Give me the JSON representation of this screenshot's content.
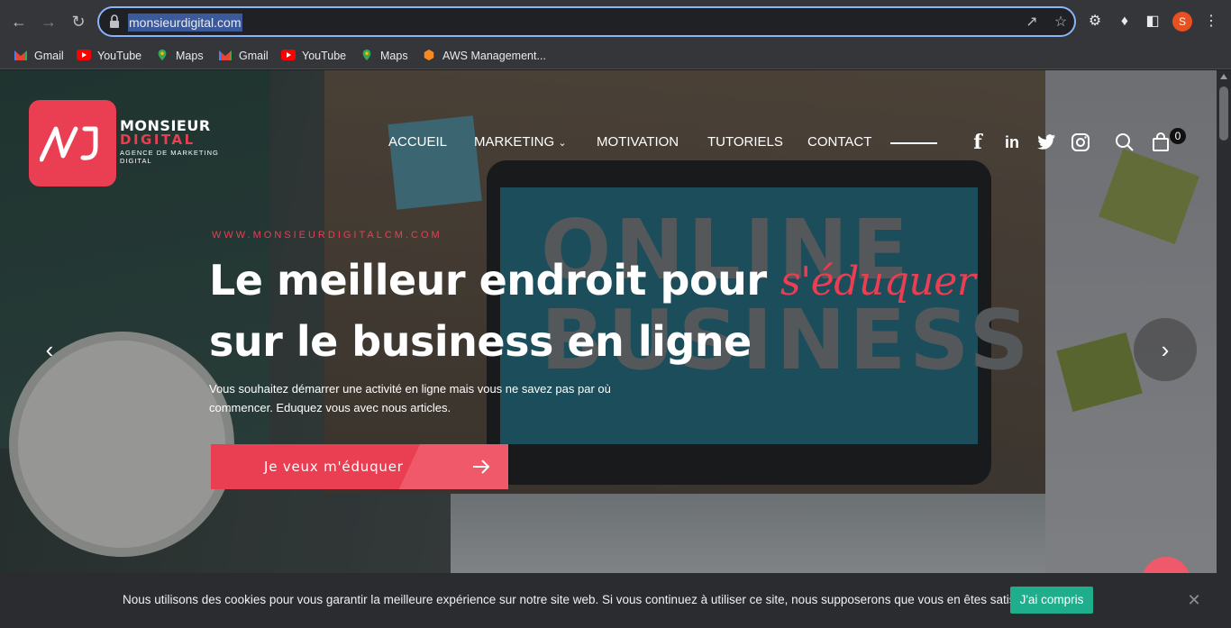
{
  "browser": {
    "url": "monsieurdigital.com",
    "profile_initial": "S",
    "accent_color": "#8ab4f8",
    "icons": [
      "back-icon",
      "forward-icon",
      "reload-icon",
      "lock-icon",
      "share-icon",
      "star-icon",
      "extension-icon",
      "puzzle-icon",
      "sidepanel-icon",
      "menu-icon"
    ]
  },
  "bookmarks": [
    {
      "label": "Gmail",
      "icon": "gmail-icon"
    },
    {
      "label": "YouTube",
      "icon": "youtube-icon"
    },
    {
      "label": "Maps",
      "icon": "maps-icon"
    },
    {
      "label": "Gmail",
      "icon": "gmail-icon"
    },
    {
      "label": "YouTube",
      "icon": "youtube-icon"
    },
    {
      "label": "Maps",
      "icon": "maps-icon"
    },
    {
      "label": "AWS Management...",
      "icon": "aws-icon"
    }
  ],
  "site": {
    "brand_color": "#ea3e52",
    "logo": {
      "line1": "MONSIEUR",
      "line2": "DIGITAL",
      "line3": "AGENCE DE MARKETING DIGITAL"
    },
    "menu": [
      {
        "label": "ACCUEIL"
      },
      {
        "label": "MARKETING",
        "has_dropdown": true
      },
      {
        "label": "MOTIVATION"
      },
      {
        "label": "TUTORIELS"
      },
      {
        "label": "CONTACT"
      }
    ],
    "social": [
      "facebook-icon",
      "linkedin-icon",
      "twitter-icon",
      "instagram-icon"
    ],
    "cart_count": "0"
  },
  "hero": {
    "eyebrow": "WWW.MONSIEURDIGITALCM.COM",
    "title_part1": "Le meilleur endroit pour ",
    "title_accent": "s'éduquer",
    "title_part2": "sur le business en ligne",
    "paragraph": "Vous souhaitez démarrer une activité en ligne mais vous ne savez pas par où commencer. Eduquez vous avec nous articles.",
    "cta_label": "Je veux m'éduquer",
    "background_text": "ONLINE BUSINESS"
  },
  "cookie": {
    "text": "Nous utilisons des cookies pour vous garantir la meilleure expérience sur notre site web. Si vous continuez à utiliser ce site, nous supposerons que vous en êtes satisfait.",
    "accept_label": "J'ai compris",
    "accept_color": "#1fae8b"
  }
}
